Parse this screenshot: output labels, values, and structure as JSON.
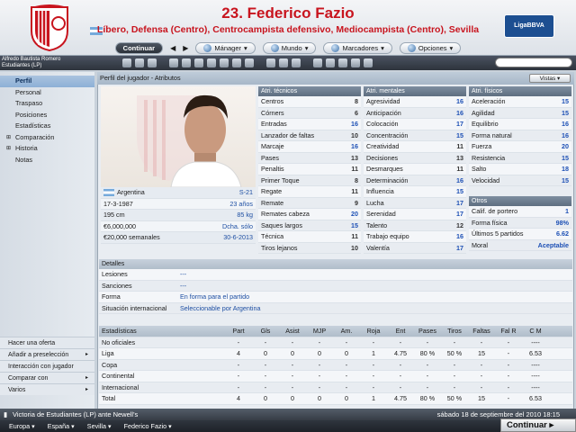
{
  "header": {
    "title": "23. Federico Fazio",
    "positions": "Líbero, Defensa (Centro), Centrocampista defensivo, Mediocampista (Centro), Sevilla",
    "league_logo": "LigaBBVA"
  },
  "toolbar": {
    "continue_label": "Continuar",
    "manager_label": "Mánager",
    "world_label": "Mundo",
    "bookmarks_label": "Marcadores",
    "options_label": "Opciones"
  },
  "iconbar": {
    "club_line1": "Alfredo Bautista Romero",
    "club_line2": "Estudiantes (LP)"
  },
  "sidebar": {
    "items": [
      "Perfil",
      "Personal",
      "Traspaso",
      "Posiciones",
      "Estadísticas",
      "Comparación",
      "Historia",
      "Notas"
    ],
    "actions": [
      "Hacer una oferta",
      "Añadir a preselección",
      "Interacción con jugador",
      "Comparar con",
      "Varios"
    ]
  },
  "main": {
    "heading": "Perfil del jugador - Atributos",
    "views_label": "Vistas"
  },
  "player_info": {
    "nationality": "Argentina",
    "u21": "S-21",
    "birthdate": "17-3-1987",
    "age": "23 años",
    "height": "195 cm",
    "weight": "85 kg",
    "value": "€6,000,000",
    "foot": "Dcha. sólo",
    "wage": "€20,000 semanales",
    "contract": "30-6-2013"
  },
  "technical": {
    "header": "Atri. técnicos",
    "rows": [
      [
        "Centros",
        "8"
      ],
      [
        "Córners",
        "6"
      ],
      [
        "Entradas",
        "16"
      ],
      [
        "Lanzador de faltas",
        "10"
      ],
      [
        "Marcaje",
        "16"
      ],
      [
        "Pases",
        "13"
      ],
      [
        "Penaltis",
        "11"
      ],
      [
        "Primer Toque",
        "8"
      ],
      [
        "Regate",
        "11"
      ],
      [
        "Remate",
        "9"
      ],
      [
        "Remates cabeza",
        "20"
      ],
      [
        "Saques largos",
        "15"
      ],
      [
        "Técnica",
        "11"
      ],
      [
        "Tiros lejanos",
        "10"
      ]
    ]
  },
  "mental": {
    "header": "Atri. mentales",
    "rows": [
      [
        "Agresividad",
        "16"
      ],
      [
        "Anticipación",
        "16"
      ],
      [
        "Colocación",
        "17"
      ],
      [
        "Concentración",
        "15"
      ],
      [
        "Creatividad",
        "11"
      ],
      [
        "Decisiones",
        "13"
      ],
      [
        "Desmarques",
        "11"
      ],
      [
        "Determinación",
        "16"
      ],
      [
        "Influencia",
        "15"
      ],
      [
        "Lucha",
        "17"
      ],
      [
        "Serenidad",
        "17"
      ],
      [
        "Talento",
        "12"
      ],
      [
        "Trabajo equipo",
        "16"
      ],
      [
        "Valentía",
        "17"
      ]
    ]
  },
  "physical": {
    "header": "Atri. físicos",
    "rows": [
      [
        "Aceleración",
        "15"
      ],
      [
        "Agilidad",
        "15"
      ],
      [
        "Equilibrio",
        "16"
      ],
      [
        "Forma natural",
        "16"
      ],
      [
        "Fuerza",
        "20"
      ],
      [
        "Resistencia",
        "15"
      ],
      [
        "Salto",
        "18"
      ],
      [
        "Velocidad",
        "15"
      ]
    ]
  },
  "otros": {
    "header": "Otros",
    "rows": [
      [
        "Calif. de portero",
        "1"
      ],
      [
        "Forma física",
        "98%"
      ],
      [
        "Últimos 5 partidos",
        "6.62"
      ],
      [
        "Moral",
        "Aceptable"
      ]
    ]
  },
  "details": {
    "header": "Detalles",
    "rows": [
      [
        "Lesiones",
        "---"
      ],
      [
        "Sanciones",
        "---"
      ],
      [
        "Forma",
        "En forma para el partido"
      ],
      [
        "Situación internacional",
        "Seleccionable por Argentina"
      ]
    ]
  },
  "stats": {
    "headers": [
      "Estadísticas",
      "Part",
      "Gls",
      "Asist",
      "MJP",
      "Am.",
      "Roja",
      "Ent",
      "Pases",
      "Tiros",
      "Faltas",
      "Fal R",
      "C M"
    ],
    "rows": [
      [
        "No oficiales",
        "-",
        "-",
        "-",
        "-",
        "-",
        "-",
        "-",
        "-",
        "-",
        "-",
        "-",
        "----"
      ],
      [
        "Liga",
        "4",
        "0",
        "0",
        "0",
        "0",
        "1",
        "4.75",
        "80 %",
        "50 %",
        "15",
        "-",
        "6.53"
      ],
      [
        "Copa",
        "-",
        "-",
        "-",
        "-",
        "-",
        "-",
        "-",
        "-",
        "-",
        "-",
        "-",
        "----"
      ],
      [
        "Continental",
        "-",
        "-",
        "-",
        "-",
        "-",
        "-",
        "-",
        "-",
        "-",
        "-",
        "-",
        "----"
      ],
      [
        "Internacional",
        "-",
        "-",
        "-",
        "-",
        "-",
        "-",
        "-",
        "-",
        "-",
        "-",
        "-",
        "----"
      ],
      [
        "Total",
        "4",
        "0",
        "0",
        "0",
        "0",
        "1",
        "4.75",
        "80 %",
        "50 %",
        "15",
        "-",
        "6.53"
      ]
    ]
  },
  "statusbar": {
    "match": "Victoria de Estudiantes (LP) ante Newell's",
    "date": "sábado 18 de septiembre del 2010 18:15"
  },
  "breadcrumb": [
    "Europa",
    "España",
    "Sevilla",
    "Federico Fazio"
  ],
  "continue_bottom": "Continuar",
  "colors": {
    "accent": "#c8141e",
    "link": "#1e4fa3"
  }
}
